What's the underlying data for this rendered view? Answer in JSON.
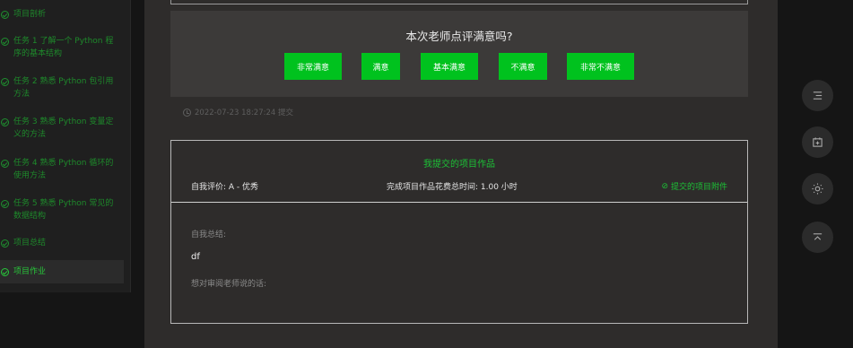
{
  "sidebar": {
    "items": [
      {
        "label": "项目剖析"
      },
      {
        "label": "任务 1 了解一个 Python 程序的基本结构"
      },
      {
        "label": "任务 2 熟悉 Python 包引用方法"
      },
      {
        "label": "任务 3 熟悉 Python 变量定义的方法"
      },
      {
        "label": "任务 4 熟悉 Python 循环的使用方法"
      },
      {
        "label": "任务 5 熟悉 Python 常见的数据结构"
      },
      {
        "label": "项目总结"
      },
      {
        "label": "项目作业"
      }
    ]
  },
  "survey": {
    "title": "本次老师点评满意吗?",
    "options": [
      "非常满意",
      "满意",
      "基本满意",
      "不满意",
      "非常不满意"
    ],
    "button_color": "#00c21e"
  },
  "timestamp": "2022-07-23 18:27:24 提交",
  "work": {
    "title": "我提交的项目作品",
    "self_eval": "自我评价:  A - 优秀",
    "total_time": "完成项目作品花费总时间:  1.00 小时",
    "attachment_link": "提交的项目附件",
    "summary_label": "自我总结:",
    "summary_value": "df",
    "reviewer_label": "想对审阅老师说的话:"
  },
  "tools": [
    {
      "icon": "list-indent-icon"
    },
    {
      "icon": "calendar-add-icon"
    },
    {
      "icon": "brightness-icon"
    },
    {
      "icon": "back-to-top-icon"
    }
  ],
  "colors": {
    "accent_green": "#1cc236",
    "background": "#2e2c2b",
    "panel": "#3c3a39"
  }
}
